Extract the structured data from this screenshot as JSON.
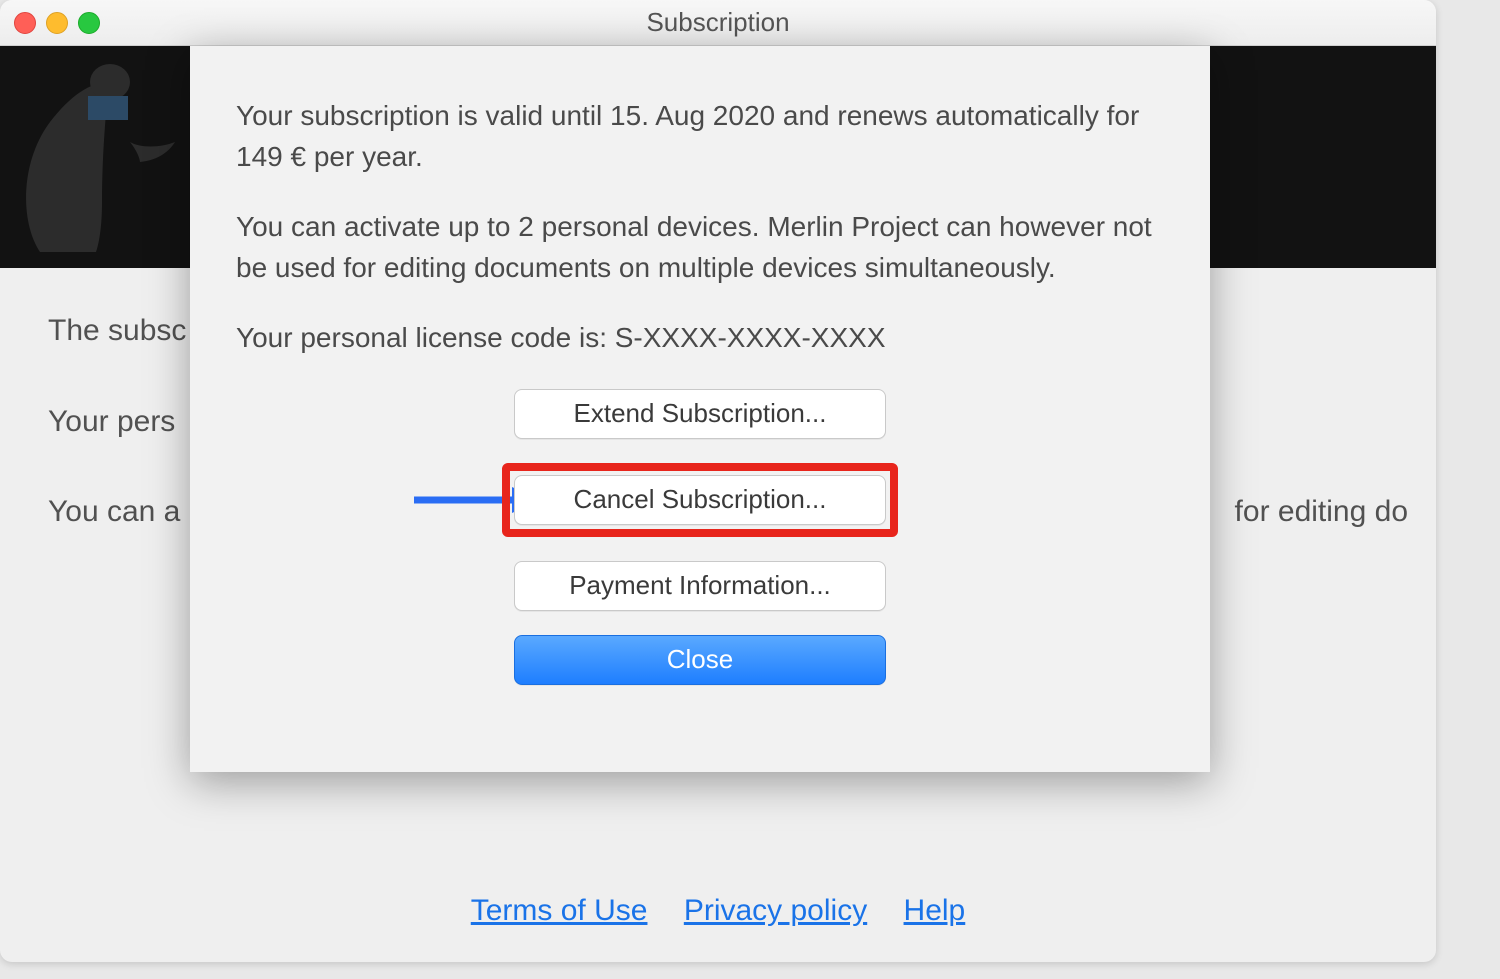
{
  "window": {
    "title": "Subscription"
  },
  "background": {
    "line1": "The subsc",
    "line2": "Your pers",
    "line3_part_a": "You can a",
    "line3_part_b": "for editing do"
  },
  "sheet": {
    "paragraph1": "Your subscription is valid until 15. Aug 2020 and renews automatically for 149 € per year.",
    "paragraph2": "You can activate up to 2 personal devices. Merlin Project can however not be used for editing documents on multiple devices simultaneously.",
    "license_line": "Your personal license code is: S-XXXX-XXXX-XXXX",
    "buttons": {
      "extend": "Extend Subscription...",
      "cancel": "Cancel Subscription...",
      "payment": "Payment Information...",
      "close": "Close"
    }
  },
  "footer": {
    "terms": "Terms of Use",
    "privacy": "Privacy policy",
    "help": "Help"
  },
  "colors": {
    "highlight": "#e8251c",
    "arrow": "#2a6df4"
  }
}
